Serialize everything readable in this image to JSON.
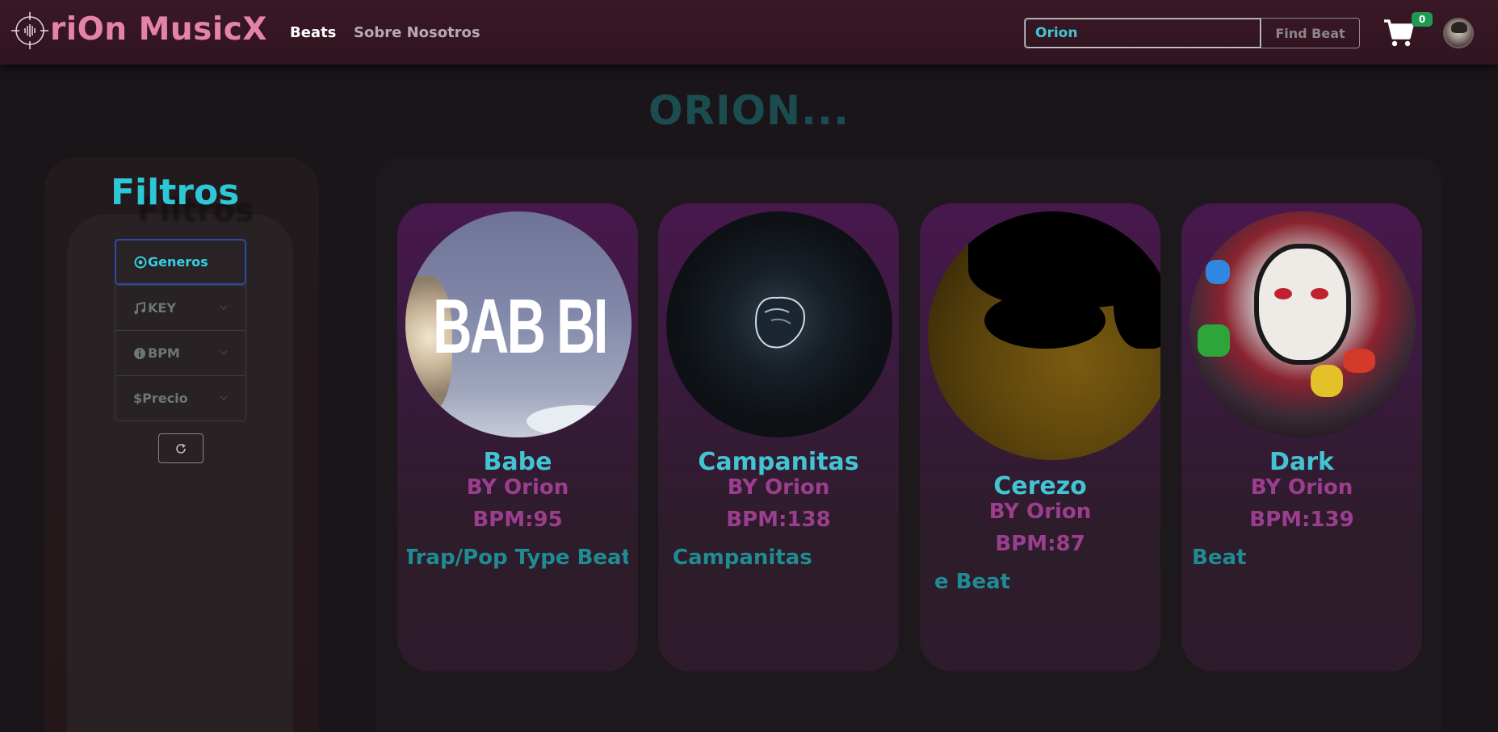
{
  "navbar": {
    "brand": "riOn MusicX",
    "links": [
      "Beats",
      "Sobre Nosotros"
    ],
    "search": {
      "value": "Orion",
      "button": "Find Beat"
    },
    "cart_count": "0"
  },
  "page_title": "ORION...",
  "sidebar": {
    "title": "Filtros",
    "shadow_text": "Filtros",
    "filters": [
      {
        "icon": "genre-circle-icon",
        "label": "Generos"
      },
      {
        "icon": "music-note-icon",
        "label": "KEY"
      },
      {
        "icon": "info-circle-icon",
        "label": "BPM"
      },
      {
        "icon": "dollar-icon",
        "label": "Precio"
      }
    ],
    "active_filter": "Generos"
  },
  "beats": [
    {
      "title": "Babe",
      "by": "BY Orion",
      "bpm": "BPM:95",
      "desc": "Trap/Pop Type Beat",
      "image_text": "BAB BI"
    },
    {
      "title": "Campanitas",
      "by": "BY Orion",
      "bpm": "BPM:138",
      "desc": "Campanitas"
    },
    {
      "title": "Cerezo",
      "by": "BY Orion",
      "bpm": "BPM:87",
      "desc": "e Beat"
    },
    {
      "title": "Dark",
      "by": "BY Orion",
      "bpm": "BPM:139",
      "desc": "Beat"
    }
  ],
  "colors": {
    "brand_pink": "#e483a8",
    "accent_cyan": "#2dc7d6",
    "card_purple": "#48184d",
    "by_purple": "#9b3e8e",
    "badge_green": "#1f9a52"
  }
}
